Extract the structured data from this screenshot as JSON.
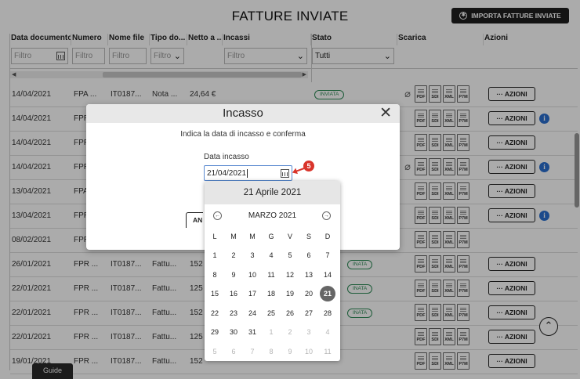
{
  "page": {
    "title": "FATTURE INVIATE",
    "import_label": "IMPORTA FATTURE INVIATE",
    "guide_label": "Guide"
  },
  "columns": [
    {
      "label": "Data documento"
    },
    {
      "label": "Numero"
    },
    {
      "label": "Nome file"
    },
    {
      "label": "Tipo do..."
    },
    {
      "label": "Netto a ..."
    },
    {
      "label": "Incassi"
    },
    {
      "label": "Stato"
    },
    {
      "label": "Scarica"
    },
    {
      "label": "Azioni"
    }
  ],
  "filters": {
    "data_placeholder": "Filtro",
    "numero_placeholder": "Filtro",
    "nome_placeholder": "Filtro",
    "tipo_placeholder": "Filtro",
    "incassi_placeholder": "Filtro",
    "stato_value": "Tutti"
  },
  "download_labels": [
    "PDF",
    "SDI",
    "XML",
    "P7M"
  ],
  "action_label": "··· AZIONI",
  "info_label": "i",
  "rows": [
    {
      "date": "14/04/2021",
      "numero": "FPA ...",
      "nome": "IT0187...",
      "tipo": "Nota ...",
      "netto": "24,64 €",
      "stato": "INVIATA"
    },
    {
      "date": "14/04/2021",
      "numero": "FPR",
      "nome": "",
      "tipo": "",
      "netto": "",
      "stato": ""
    },
    {
      "date": "14/04/2021",
      "numero": "FPR",
      "nome": "",
      "tipo": "",
      "netto": "",
      "stato": ""
    },
    {
      "date": "14/04/2021",
      "numero": "FPR",
      "nome": "",
      "tipo": "",
      "netto": "",
      "stato": ""
    },
    {
      "date": "13/04/2021",
      "numero": "FPA",
      "nome": "",
      "tipo": "",
      "netto": "",
      "stato": ""
    },
    {
      "date": "13/04/2021",
      "numero": "FPR",
      "nome": "",
      "tipo": "",
      "netto": "",
      "stato": ""
    },
    {
      "date": "08/02/2021",
      "numero": "FPR",
      "nome": "",
      "tipo": "",
      "netto": "",
      "stato": ""
    },
    {
      "date": "26/01/2021",
      "numero": "FPR ...",
      "nome": "IT0187...",
      "tipo": "Fattu...",
      "netto": "152",
      "stato": "INATA"
    },
    {
      "date": "22/01/2021",
      "numero": "FPR ...",
      "nome": "IT0187...",
      "tipo": "Fattu...",
      "netto": "125",
      "stato": "INATA"
    },
    {
      "date": "22/01/2021",
      "numero": "FPR ...",
      "nome": "IT0187...",
      "tipo": "Fattu...",
      "netto": "152",
      "stato": "INATA"
    },
    {
      "date": "22/01/2021",
      "numero": "FPR ...",
      "nome": "IT0187...",
      "tipo": "Fattu...",
      "netto": "125",
      "stato": ""
    },
    {
      "date": "19/01/2021",
      "numero": "FPR ...",
      "nome": "IT0187...",
      "tipo": "Fattu...",
      "netto": "152",
      "stato": ""
    }
  ],
  "modal": {
    "title": "Incasso",
    "close": "✕",
    "description": "Indica la data di incasso e conferma",
    "field_label": "Data incasso",
    "date_value": "21/04/2021",
    "cancel_button_partial": "AN",
    "step_number": "5"
  },
  "datepicker": {
    "selected_label": "21 Aprile 2021",
    "month_label": "MARZO 2021",
    "weekdays": [
      "L",
      "M",
      "M",
      "G",
      "V",
      "S",
      "D"
    ],
    "days": [
      [
        "1",
        "2",
        "3",
        "4",
        "5",
        "6",
        "7"
      ],
      [
        "8",
        "9",
        "10",
        "11",
        "12",
        "13",
        "14"
      ],
      [
        "15",
        "16",
        "17",
        "18",
        "19",
        "20",
        "21"
      ],
      [
        "22",
        "23",
        "24",
        "25",
        "26",
        "27",
        "28"
      ],
      [
        "29",
        "30",
        "31",
        "1",
        "2",
        "3",
        "4"
      ],
      [
        "5",
        "6",
        "7",
        "8",
        "9",
        "10",
        "11"
      ]
    ],
    "selected_day": "21"
  },
  "icons": {
    "import": "gear-icon",
    "calendar": "calendar-icon",
    "attachment": "paperclip-icon",
    "info": "info-icon",
    "scroll_up": "chevron-up-icon",
    "close": "close-icon"
  }
}
